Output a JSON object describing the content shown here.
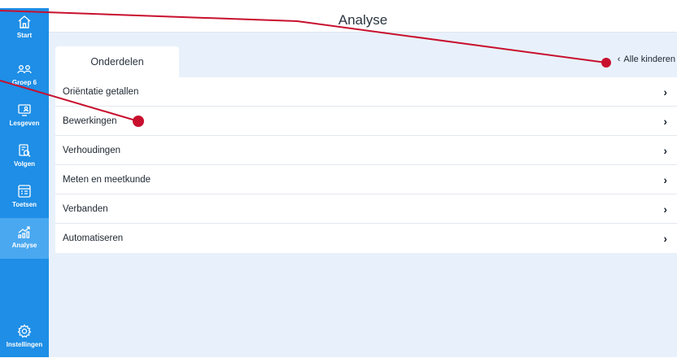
{
  "sidebar": {
    "items": [
      {
        "label": "Start",
        "icon": "home-icon"
      },
      {
        "label": "Groep 6",
        "icon": "group-icon"
      },
      {
        "label": "Lesgeven",
        "icon": "teach-icon"
      },
      {
        "label": "Volgen",
        "icon": "follow-icon"
      },
      {
        "label": "Toetsen",
        "icon": "test-icon"
      },
      {
        "label": "Analyse",
        "icon": "analysis-icon",
        "active": true
      },
      {
        "label": "Instellingen",
        "icon": "gear-icon"
      }
    ]
  },
  "header": {
    "title": "Analyse"
  },
  "main": {
    "tab_label": "Onderdelen",
    "back_link": "Alle kinderen",
    "rows": [
      {
        "label": "Oriëntatie getallen"
      },
      {
        "label": "Bewerkingen"
      },
      {
        "label": "Verhoudingen"
      },
      {
        "label": "Meten en meetkunde"
      },
      {
        "label": "Verbanden"
      },
      {
        "label": "Automatiseren"
      }
    ]
  },
  "colors": {
    "sidebar": "#1e8ee6",
    "sidebar_active": "#4aa8f0",
    "background": "#e8f1fb",
    "annotation": "#c8102e"
  }
}
